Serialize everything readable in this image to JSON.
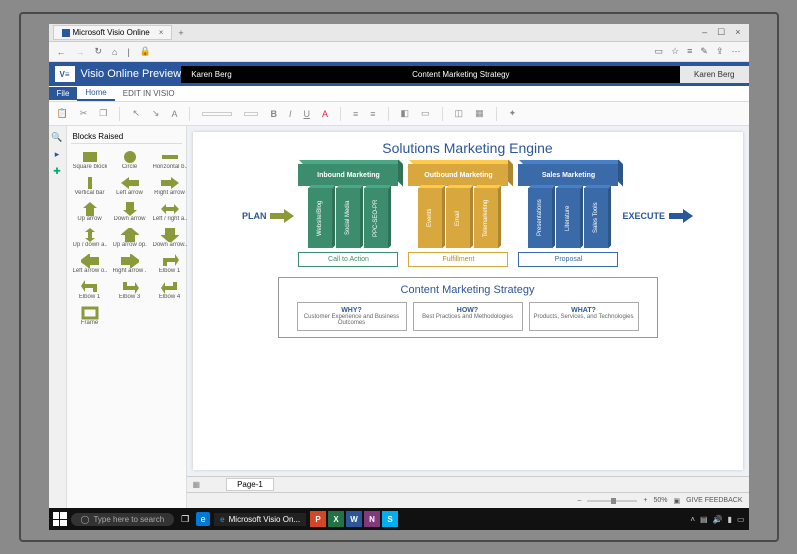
{
  "browser": {
    "tab": "Microsoft Visio Online",
    "window_controls": [
      "–",
      "☐",
      "×"
    ]
  },
  "app": {
    "logo": "V≡",
    "title": "Visio Online Preview",
    "user_left": "Karen Berg",
    "doc": "Content Marketing Strategy",
    "user_right": "Karen Berg"
  },
  "ribbon_tabs": {
    "file": "File",
    "home": "Home",
    "edit": "EDIT IN VISIO"
  },
  "toolbar": {
    "undo": "↶",
    "redo": "↷",
    "bold": "B",
    "italic": "I",
    "underline": "U"
  },
  "shapes": {
    "header": "Blocks Raised",
    "items": [
      "Square block",
      "Circle",
      "Horizontal b...",
      "Vertical bar",
      "Left arrow",
      "Right arrow",
      "Up arrow",
      "Down arrow",
      "Left / right a...",
      "Up / down a...",
      "Up arrow op...",
      "Down arrow...",
      "Left arrow o...",
      "Right arrow ...",
      "Elbow 1",
      "Elbow 1",
      "Elbow 3",
      "Elbow 4",
      "Frame"
    ]
  },
  "diagram": {
    "title": "Solutions Marketing Engine",
    "plan": "PLAN",
    "execute": "EXECUTE",
    "cols": [
      {
        "header": "Inbound Marketing",
        "pillars": [
          "Website/Blog",
          "Social Media",
          "PPC-SEO-PR"
        ],
        "footer": "Call to Action"
      },
      {
        "header": "Outbound Marketing",
        "pillars": [
          "Events",
          "Email",
          "Telemarketing"
        ],
        "footer": "Fulfillment"
      },
      {
        "header": "Sales Marketing",
        "pillars": [
          "Presentations",
          "Literature",
          "Sales Tools"
        ],
        "footer": "Proposal"
      }
    ],
    "cms": {
      "title": "Content Marketing Strategy",
      "items": [
        {
          "h": "WHY?",
          "t": "Customer Experience and Business Outcomes"
        },
        {
          "h": "HOW?",
          "t": "Best Practices and Methodologies"
        },
        {
          "h": "WHAT?",
          "t": "Products, Services, and Technologies"
        }
      ]
    }
  },
  "page_tab": "Page-1",
  "status": {
    "zoom": "50%",
    "feedback": "GIVE FEEDBACK"
  },
  "taskbar": {
    "search": "Type here to search",
    "app": "Microsoft Visio On...",
    "apps": [
      {
        "bg": "#d24726",
        "t": "P"
      },
      {
        "bg": "#217346",
        "t": "X"
      },
      {
        "bg": "#2b579a",
        "t": "W"
      },
      {
        "bg": "#80397b",
        "t": "N"
      },
      {
        "bg": "#00aff0",
        "t": "S"
      }
    ]
  }
}
